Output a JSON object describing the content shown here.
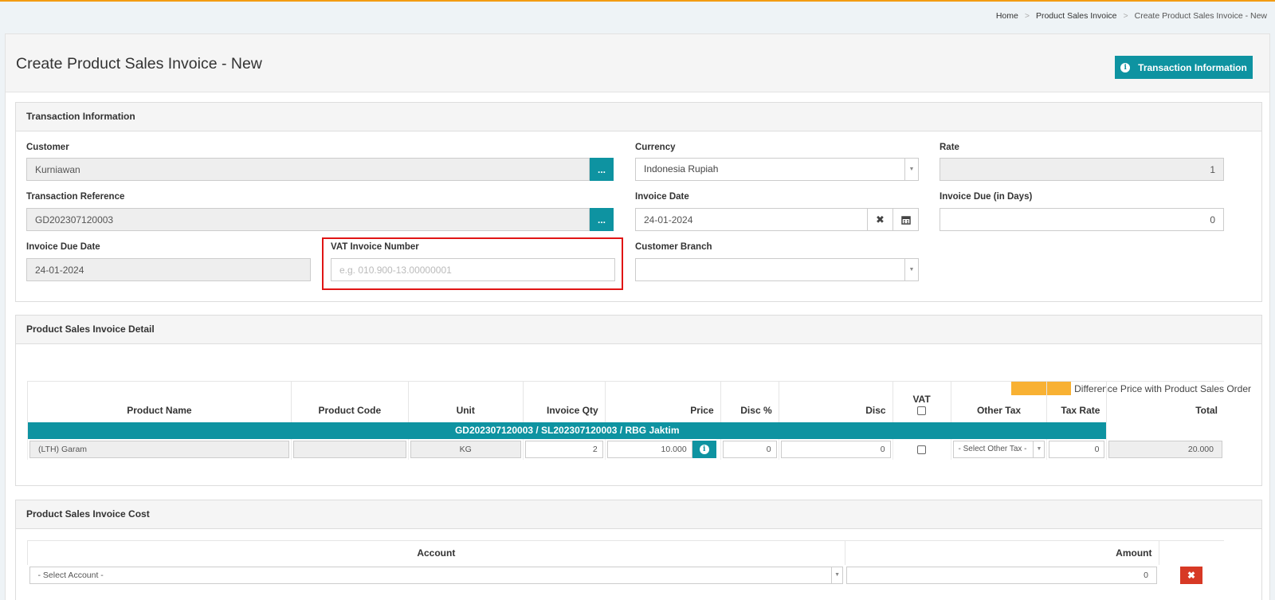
{
  "breadcrumb": {
    "home": "Home",
    "section": "Product Sales Invoice",
    "current": "Create Product Sales Invoice - New"
  },
  "page": {
    "title": "Create Product Sales Invoice - New",
    "info_button": "Transaction Information"
  },
  "transaction": {
    "heading": "Transaction Information",
    "customer_label": "Customer",
    "customer_value": "Kurniawan",
    "currency_label": "Currency",
    "currency_value": "Indonesia Rupiah",
    "rate_label": "Rate",
    "rate_value": "1",
    "reference_label": "Transaction Reference",
    "reference_value": "GD202307120003",
    "invoice_date_label": "Invoice Date",
    "invoice_date_value": "24-01-2024",
    "due_days_label": "Invoice Due (in Days)",
    "due_days_value": "0",
    "due_date_label": "Invoice Due Date",
    "due_date_value": "24-01-2024",
    "vat_label": "VAT Invoice Number",
    "vat_placeholder": "e.g. 010.900-13.00000001",
    "branch_label": "Customer Branch",
    "branch_value": "",
    "dots_label": "..."
  },
  "detail": {
    "heading": "Product Sales Invoice Detail",
    "legend_label": "Difference Price with Product Sales Order",
    "legend_color": "#f8b133",
    "columns": {
      "product_name": "Product Name",
      "product_code": "Product Code",
      "unit": "Unit",
      "qty": "Invoice Qty",
      "price": "Price",
      "disc_pct": "Disc %",
      "disc": "Disc",
      "vat": "VAT",
      "other_tax": "Other Tax",
      "tax_rate": "Tax Rate",
      "total": "Total"
    },
    "group_label": "GD202307120003 / SL202307120003 / RBG Jaktim",
    "row": {
      "product_name": "(LTH) Garam",
      "product_code": "",
      "unit": "KG",
      "qty": "2",
      "price": "10.000",
      "disc_pct": "0",
      "disc": "0",
      "other_tax": "- Select Other Tax -",
      "tax_rate": "0",
      "total": "20.000"
    }
  },
  "cost": {
    "heading": "Product Sales Invoice Cost",
    "account_header": "Account",
    "amount_header": "Amount",
    "account_placeholder": "- Select Account -",
    "amount_value": "0",
    "delete_label": "✖"
  },
  "colors": {
    "accent": "#0e93a1",
    "top_border": "#f39c12",
    "highlight": "#e01515",
    "danger": "#d73925"
  }
}
